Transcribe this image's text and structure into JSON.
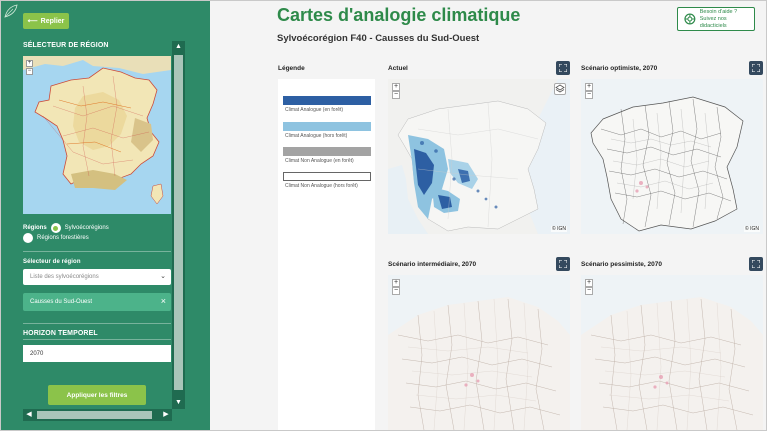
{
  "sidebar": {
    "back_label": "Replier",
    "region_selector_title": "SÉLECTEUR DE RÉGION",
    "regions_label": "Régions",
    "radio_options": [
      {
        "label": "Sylvoécorégions",
        "selected": true
      },
      {
        "label": "Régions forestières",
        "selected": false
      }
    ],
    "region_select_title": "Sélecteur de région",
    "region_select_placeholder": "Liste des sylvoécorégions",
    "selected_region_chip": "Causses du Sud-Ouest",
    "chip_remove": "×",
    "horizon_title": "HORIZON TEMPOREL",
    "horizon_value": "2070",
    "apply_label": "Appliquer les filtres",
    "icons": {
      "back": "arrow-left-icon",
      "leaf": "leaf-icon",
      "chevron": "chevron-down-icon"
    }
  },
  "header": {
    "title": "Cartes d'analogie climatique",
    "subtitle": "Sylvoécorégion F40 - Causses du Sud-Ouest",
    "help_line1": "Besoin d'aide ?",
    "help_line2": "Suivez nos didacticiels"
  },
  "legend": {
    "title": "Légende",
    "items": [
      {
        "label": "Climat Analogue (en forêt)",
        "color": "#2d5fa3"
      },
      {
        "label": "Climat Analogue (hors forêt)",
        "color": "#8ec3e0"
      },
      {
        "label": "Climat Non Analogue (en forêt)",
        "color": "#a3a3a3"
      },
      {
        "label": "Climat Non Analogue (hors forêt)",
        "color": "#ffffff"
      }
    ]
  },
  "maps": [
    {
      "title": "Actuel",
      "attribution": "© IGN"
    },
    {
      "title": "Scénario optimiste, 2070",
      "attribution": "© IGN"
    },
    {
      "title": "Scénario intermédiaire, 2070",
      "attribution": ""
    },
    {
      "title": "Scénario pessimiste, 2070",
      "attribution": ""
    }
  ],
  "colors": {
    "sidebar_bg": "#2e8a68",
    "accent_green": "#8bc34a",
    "title_green": "#2e8a4a",
    "chip_bg": "#4cb38a",
    "fullscreen_btn": "#34495e"
  }
}
